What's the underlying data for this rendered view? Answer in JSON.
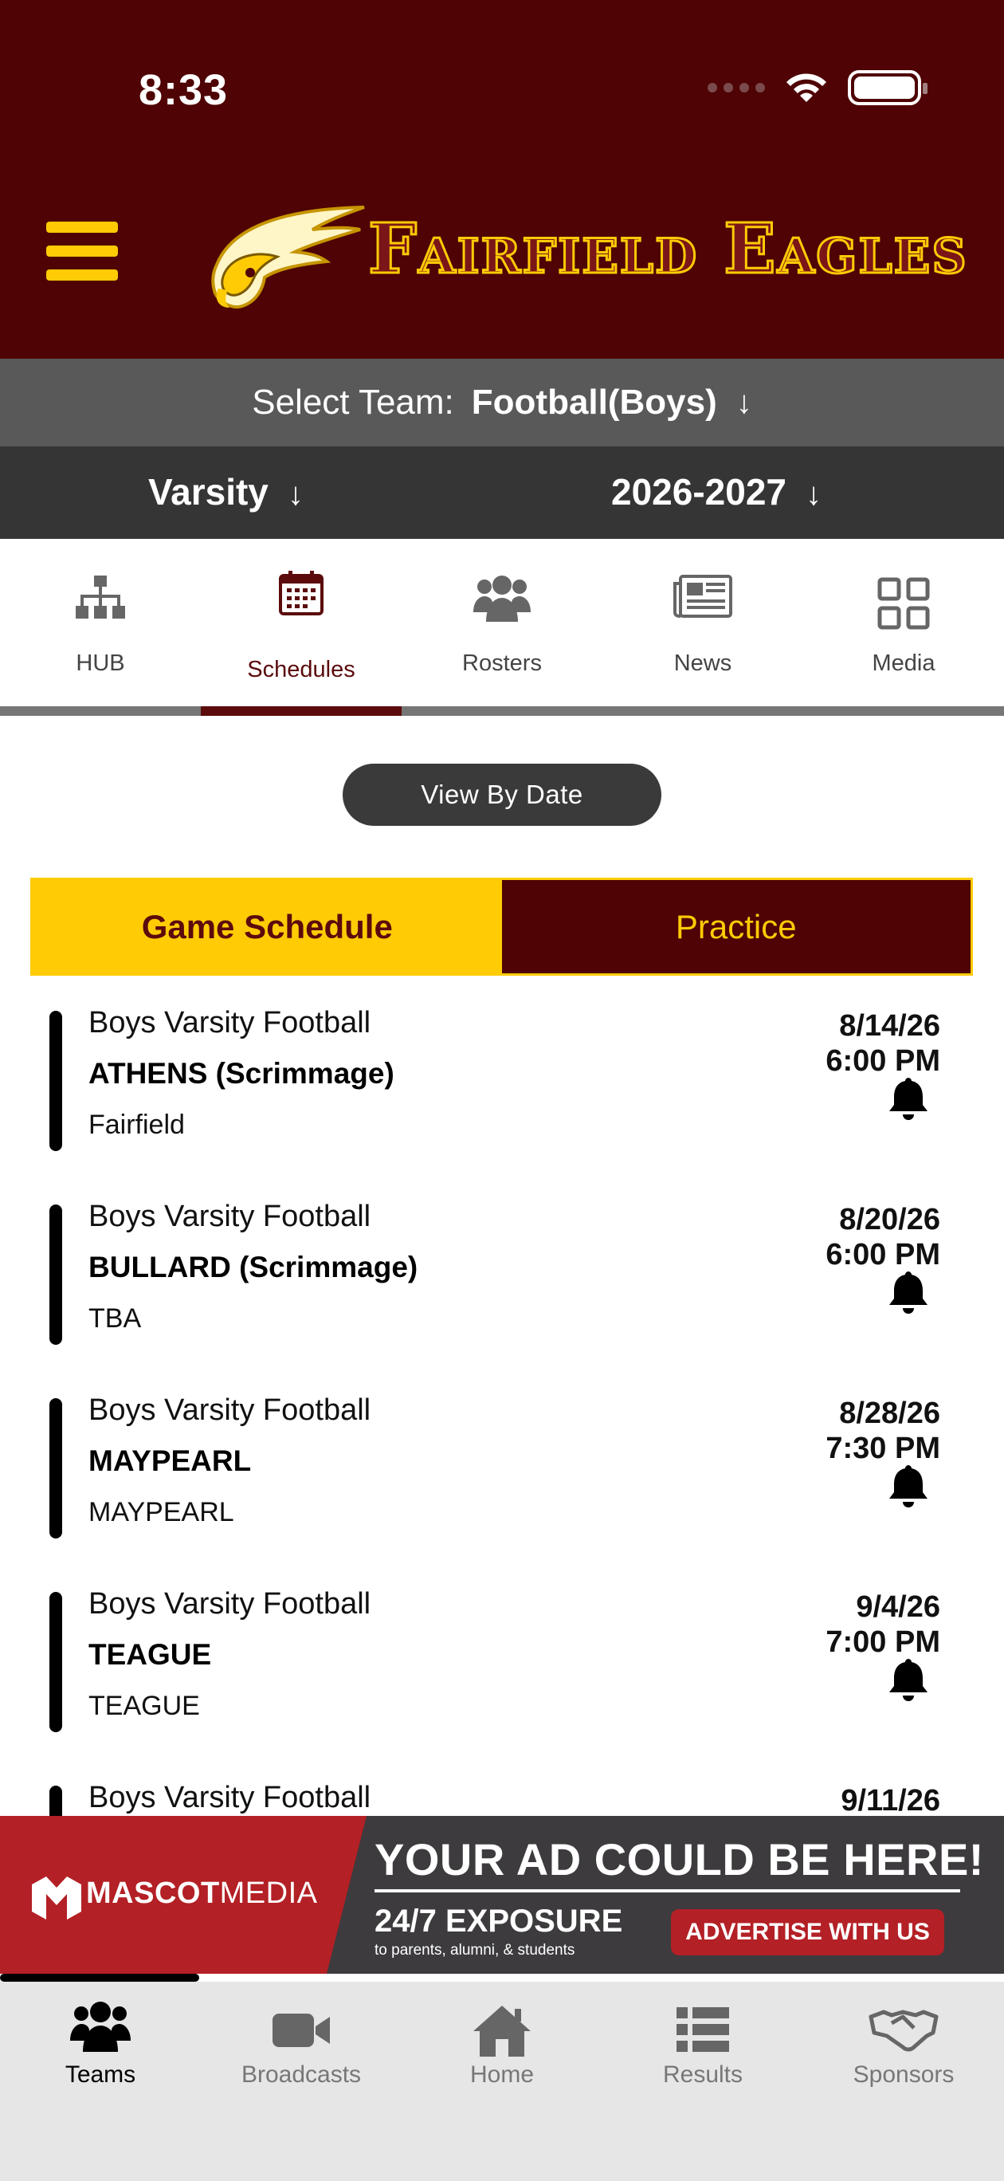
{
  "status_bar": {
    "time": "8:33"
  },
  "header": {
    "title": "Fairfield Eagles"
  },
  "team_select": {
    "label": "Select Team:",
    "value": "Football(Boys)"
  },
  "level_select": {
    "level": "Varsity",
    "season": "2026-2027"
  },
  "tabs": [
    {
      "label": "HUB",
      "icon": "hierarchy-icon"
    },
    {
      "label": "Schedules",
      "icon": "calendar-icon",
      "active": true
    },
    {
      "label": "Rosters",
      "icon": "group-icon"
    },
    {
      "label": "News",
      "icon": "newspaper-icon"
    },
    {
      "label": "Media",
      "icon": "grid-icon"
    }
  ],
  "view_by_date": "View By Date",
  "schedule_toggle": {
    "game": "Game Schedule",
    "practice": "Practice",
    "selected": "game"
  },
  "games": [
    {
      "team": "Boys Varsity Football",
      "opponent": "ATHENS (Scrimmage)",
      "location": "Fairfield",
      "date": "8/14/26",
      "time": "6:00 PM"
    },
    {
      "team": "Boys Varsity Football",
      "opponent": "BULLARD (Scrimmage)",
      "location": "TBA",
      "date": "8/20/26",
      "time": "6:00 PM"
    },
    {
      "team": "Boys Varsity Football",
      "opponent": "MAYPEARL",
      "location": "MAYPEARL",
      "date": "8/28/26",
      "time": "7:30 PM"
    },
    {
      "team": "Boys Varsity Football",
      "opponent": "TEAGUE",
      "location": "TEAGUE",
      "date": "9/4/26",
      "time": "7:00 PM"
    },
    {
      "team": "Boys Varsity Football",
      "opponent": "",
      "location": "",
      "date": "9/11/26",
      "time": ""
    }
  ],
  "ad": {
    "brand_bold": "MASCOT",
    "brand_light": "MEDIA",
    "headline": "YOUR AD COULD BE HERE!",
    "exposure": "24/7 EXPOSURE",
    "exposure_sub": "to parents, alumni, & students",
    "cta": "ADVERTISE WITH US"
  },
  "bottom_nav": [
    {
      "label": "Teams",
      "icon": "teams-icon",
      "active": true
    },
    {
      "label": "Broadcasts",
      "icon": "video-camera-icon"
    },
    {
      "label": "Home",
      "icon": "home-icon"
    },
    {
      "label": "Results",
      "icon": "list-icon"
    },
    {
      "label": "Sponsors",
      "icon": "handshake-icon"
    }
  ],
  "colors": {
    "maroon": "#4f0304",
    "gold": "#ffcb05",
    "dark_gray": "#353535",
    "mid_gray": "#595959"
  }
}
